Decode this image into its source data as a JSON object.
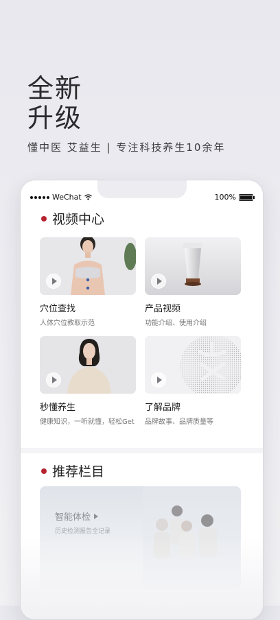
{
  "hero": {
    "title_line1": "全新",
    "title_line2": "升级",
    "subtitle": "懂中医 艾益生  |  专注科技养生10余年"
  },
  "status_bar": {
    "carrier": "WeChat",
    "battery": "100%"
  },
  "video_center": {
    "title": "视频中心",
    "cards": [
      {
        "title": "穴位查找",
        "desc": "人体穴位教取示范"
      },
      {
        "title": "产品视频",
        "desc": "功能介绍、使用介绍"
      },
      {
        "title": "秒懂养生",
        "desc": "健康知识，一听就懂，轻松Get"
      },
      {
        "title": "了解品牌",
        "desc": "品牌故事、品牌质量等"
      }
    ]
  },
  "recommend": {
    "title": "推荐栏目",
    "banner_title": "智能体检",
    "banner_sub": "历史检测报告全记录"
  },
  "colors": {
    "accent_red": "#b62430",
    "background": "#ececf1"
  }
}
